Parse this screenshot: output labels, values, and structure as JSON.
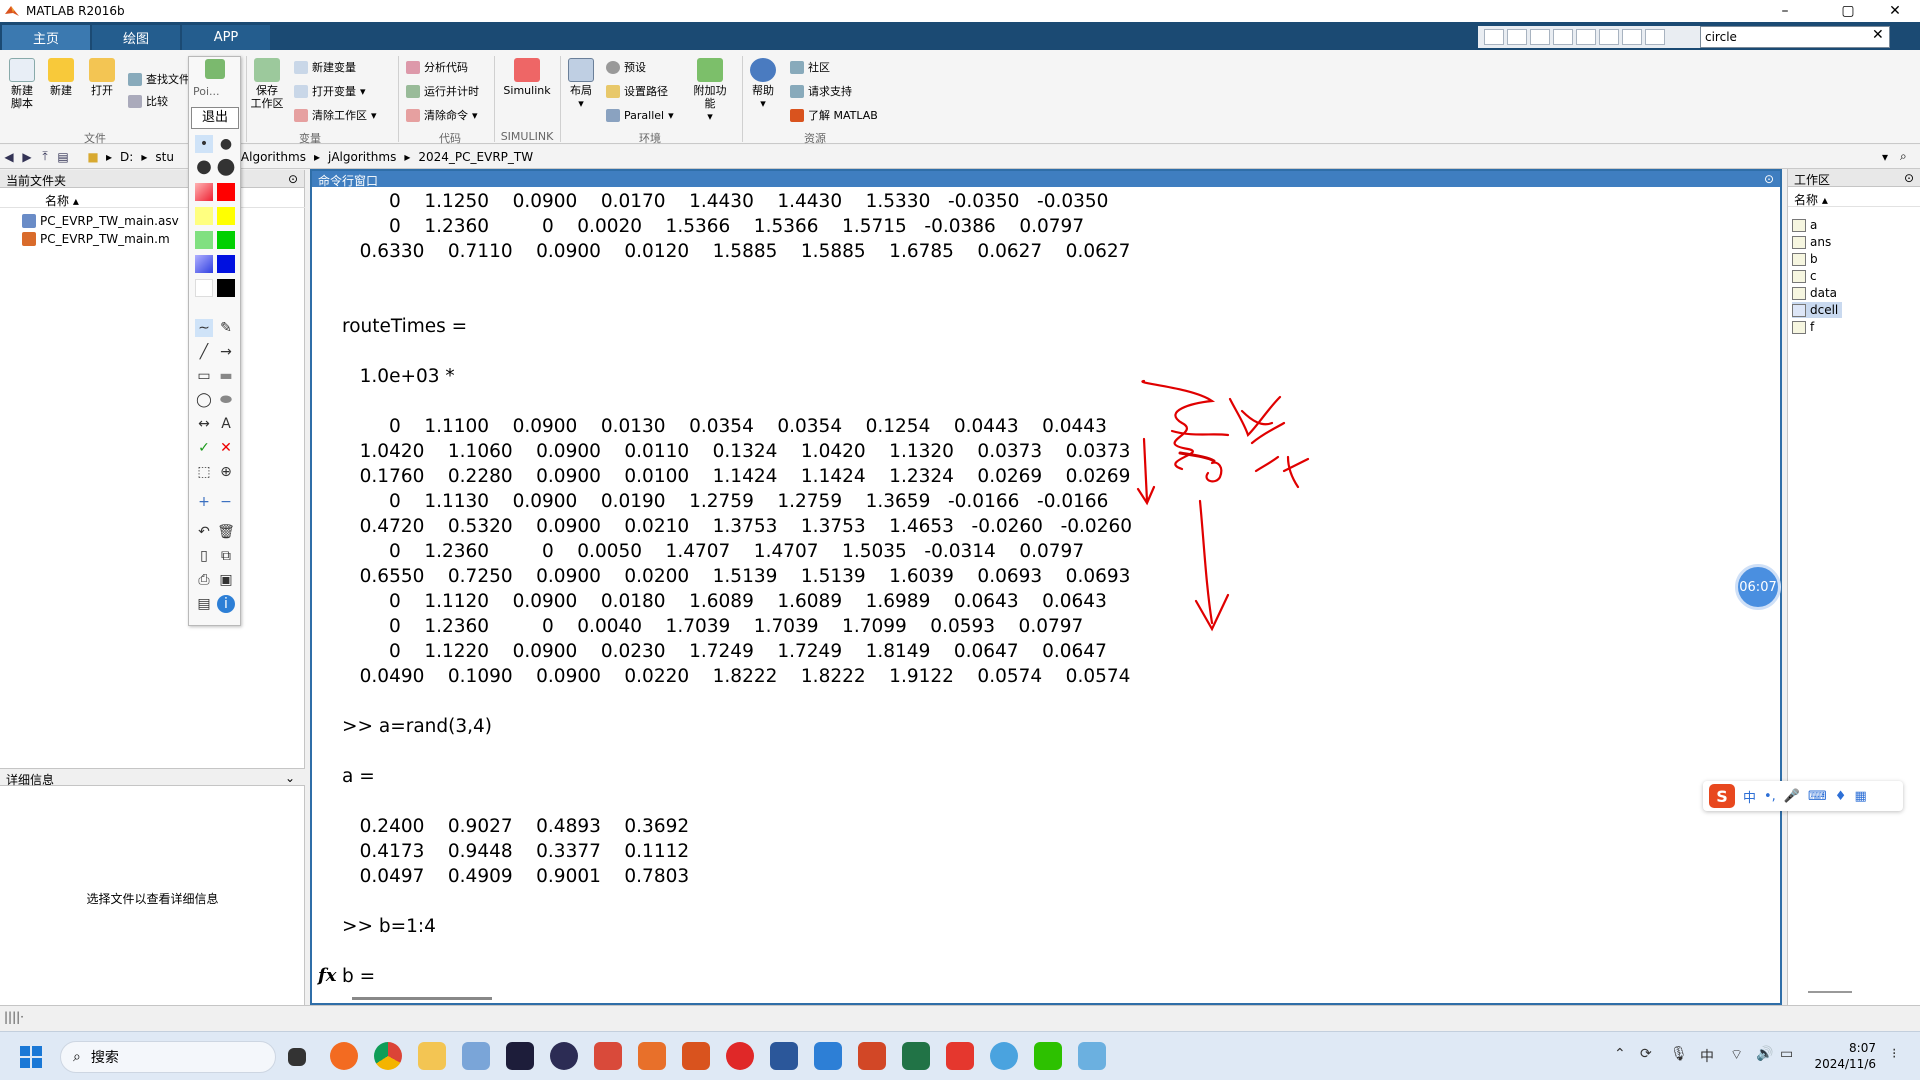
{
  "app": {
    "title": "MATLAB R2016b",
    "colors": {
      "ribbon_dark": "#1b4a73",
      "tab_active": "#3b79b0",
      "cmd_header": "#3f7ec0",
      "annotation_ink": "#e00000"
    }
  },
  "tabs": [
    {
      "label": "主页",
      "active": true
    },
    {
      "label": "绘图",
      "active": false
    },
    {
      "label": "APP",
      "active": false
    }
  ],
  "search": {
    "value": "circle"
  },
  "ribbon": {
    "buttons": {
      "new_script": "新建\n脚本",
      "new": "新建",
      "open": "打开",
      "find_files": "查找文件",
      "compare": "比较",
      "save_workspace": "保存\n工作区",
      "new_variable": "新建变量",
      "open_variable": "打开变量",
      "clear_workspace": "清除工作区",
      "analyze_code": "分析代码",
      "run_and_time": "运行并计时",
      "clear_commands": "清除命令",
      "simulink": "Simulink",
      "layout": "布局",
      "preferences": "预设",
      "set_path": "设置路径",
      "parallel": "Parallel",
      "addons": "附加功能",
      "help": "帮助",
      "community": "社区",
      "request_support": "请求支持",
      "learn_matlab": "了解 MATLAB"
    },
    "groups": {
      "file": "文件",
      "variable": "变量",
      "code": "代码",
      "simulink": "SIMULINK",
      "environment": "环境",
      "resources": "资源"
    }
  },
  "address": {
    "segments": [
      "D:",
      "stu",
      "tlabAlgorithms",
      "jAlgorithms",
      "2024_PC_EVRP_TW"
    ]
  },
  "current_folder": {
    "title": "当前文件夹",
    "column": "名称",
    "files": [
      {
        "name": "PC_EVRP_TW_main.asv",
        "icon": "asv-file-icon"
      },
      {
        "name": "PC_EVRP_TW_main.m",
        "icon": "m-file-icon"
      }
    ],
    "details_title": "详细信息",
    "details_message": "选择文件以查看详细信息"
  },
  "command_window": {
    "title": "命令行窗口",
    "lines": [
      "        0    1.1250    0.0900    0.0170    1.4430    1.4430    1.5330   -0.0350   -0.0350",
      "        0    1.2360         0    0.0020    1.5366    1.5366    1.5715   -0.0386    0.0797",
      "   0.6330    0.7110    0.0900    0.0120    1.5885    1.5885    1.6785    0.0627    0.0627",
      "",
      "",
      "routeTimes =",
      "",
      "   1.0e+03 *",
      "",
      "        0    1.1100    0.0900    0.0130    0.0354    0.0354    0.1254    0.0443    0.0443",
      "   1.0420    1.1060    0.0900    0.0110    0.1324    1.0420    1.1320    0.0373    0.0373",
      "   0.1760    0.2280    0.0900    0.0100    1.1424    1.1424    1.2324    0.0269    0.0269",
      "        0    1.1130    0.0900    0.0190    1.2759    1.2759    1.3659   -0.0166   -0.0166",
      "   0.4720    0.5320    0.0900    0.0210    1.3753    1.3753    1.4653   -0.0260   -0.0260",
      "        0    1.2360         0    0.0050    1.4707    1.4707    1.5035   -0.0314    0.0797",
      "   0.6550    0.7250    0.0900    0.0200    1.5139    1.5139    1.6039    0.0693    0.0693",
      "        0    1.1120    0.0900    0.0180    1.6089    1.6089    1.6989    0.0643    0.0643",
      "        0    1.2360         0    0.0040    1.7039    1.7039    1.7099    0.0593    0.0797",
      "        0    1.1220    0.0900    0.0230    1.7249    1.7249    1.8149    0.0647    0.0647",
      "   0.0490    0.1090    0.0900    0.0220    1.8222    1.8222    1.9122    0.0574    0.0574",
      "",
      ">> a=rand(3,4)",
      "",
      "a =",
      "",
      "   0.2400    0.9027    0.4893    0.3692",
      "   0.4173    0.9448    0.3377    0.1112",
      "   0.0497    0.4909    0.9001    0.7803",
      "",
      ">> b=1:4",
      "",
      "b ="
    ],
    "prompt_symbol": "fx"
  },
  "workspace": {
    "title": "工作区",
    "column": "名称",
    "variables": [
      {
        "name": "a",
        "selected": false
      },
      {
        "name": "ans",
        "selected": false
      },
      {
        "name": "b",
        "selected": false
      },
      {
        "name": "c",
        "selected": false
      },
      {
        "name": "data",
        "selected": false
      },
      {
        "name": "dcell",
        "selected": true
      },
      {
        "name": "f",
        "selected": false
      }
    ]
  },
  "annotation_toolbar": {
    "mode_label": "Poi...",
    "exit_label": "退出"
  },
  "timer": {
    "value": "06:07"
  },
  "ime": {
    "lang": "中"
  },
  "taskbar": {
    "search_placeholder": "搜索",
    "time": "8:07",
    "date": "2024/11/6"
  }
}
